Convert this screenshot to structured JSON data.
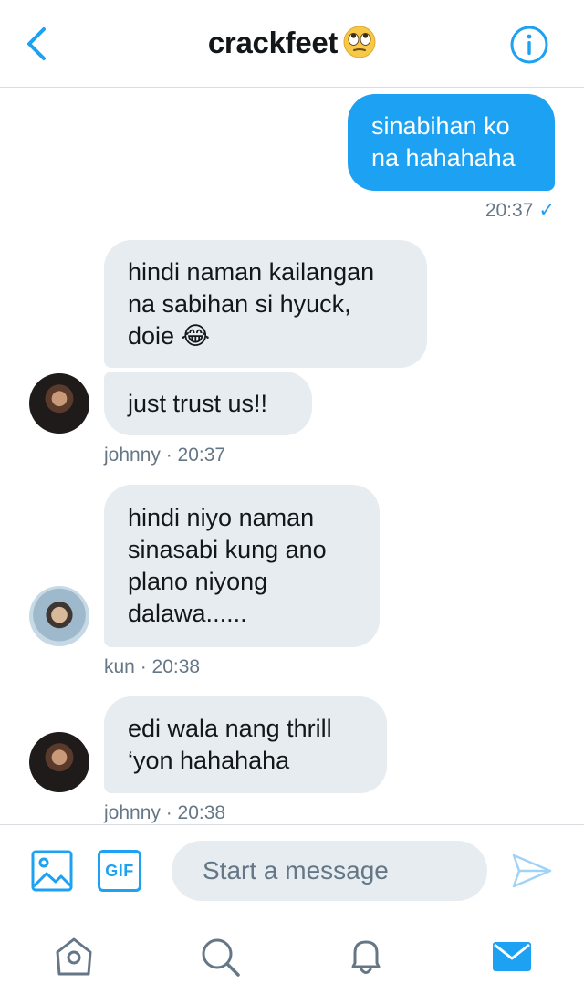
{
  "header": {
    "title": "crackfeet",
    "title_emoji": "face-with-rolling-eyes"
  },
  "messages": [
    {
      "direction": "out",
      "lines": [
        "sinabihan ko",
        "na hahahaha"
      ],
      "time": "20:37",
      "status": "✓"
    },
    {
      "direction": "in",
      "lines": [
        "hindi naman kailangan",
        "na sabihan si hyuck,",
        "doie 😂"
      ]
    },
    {
      "direction": "in",
      "lines": [
        "just trust us!!"
      ],
      "meta": "johnny · 20:37"
    },
    {
      "direction": "in",
      "lines": [
        "hindi niyo naman",
        "sinasabi kung ano",
        "plano niyong",
        "dalawa......"
      ],
      "meta": "kun · 20:38"
    },
    {
      "direction": "in",
      "lines": [
        "edi wala nang thrill",
        "‘yon hahahaha"
      ],
      "meta": "johnny · 20:38"
    }
  ],
  "composer": {
    "placeholder": "Start a message",
    "gif_label": "GIF"
  },
  "tabs": [
    {
      "icon": "home-icon",
      "active": false
    },
    {
      "icon": "search-icon",
      "active": false
    },
    {
      "icon": "bell-icon",
      "active": false
    },
    {
      "icon": "mail-icon",
      "active": true
    }
  ],
  "colors": {
    "accent": "#1da1f2",
    "bubble_in": "#e6ecf0",
    "meta_text": "#657786",
    "icon_gray": "#657786"
  }
}
